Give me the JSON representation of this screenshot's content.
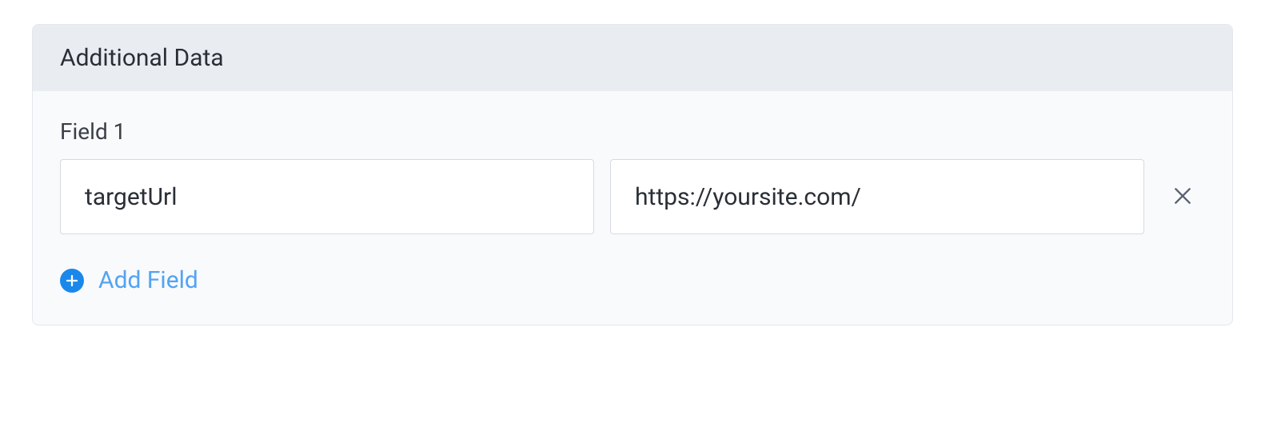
{
  "panel": {
    "title": "Additional Data"
  },
  "fields": {
    "0": {
      "label": "Field 1",
      "key": "targetUrl",
      "value": "https://yoursite.com/"
    }
  },
  "actions": {
    "addFieldLabel": "Add Field"
  }
}
